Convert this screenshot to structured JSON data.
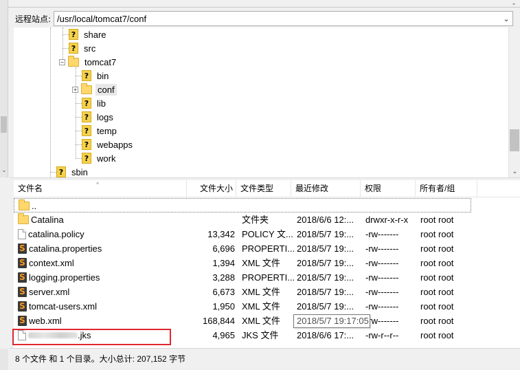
{
  "site_bar": {
    "label": "远程站点:",
    "path": "/usr/local/tomcat7/conf"
  },
  "tree": {
    "items": [
      {
        "label": "share",
        "icon": "question-folder-icon",
        "expander": ""
      },
      {
        "label": "src",
        "icon": "question-folder-icon",
        "expander": ""
      },
      {
        "label": "tomcat7",
        "icon": "folder-icon",
        "expander": "−"
      },
      {
        "label": "bin",
        "icon": "question-folder-icon",
        "expander": ""
      },
      {
        "label": "conf",
        "icon": "folder-icon",
        "expander": "+"
      },
      {
        "label": "lib",
        "icon": "question-folder-icon",
        "expander": ""
      },
      {
        "label": "logs",
        "icon": "question-folder-icon",
        "expander": ""
      },
      {
        "label": "temp",
        "icon": "question-folder-icon",
        "expander": ""
      },
      {
        "label": "webapps",
        "icon": "question-folder-icon",
        "expander": ""
      },
      {
        "label": "work",
        "icon": "question-folder-icon",
        "expander": ""
      },
      {
        "label": "sbin",
        "icon": "question-folder-icon",
        "expander": ""
      }
    ]
  },
  "file_list": {
    "columns": [
      "文件名",
      "文件大小",
      "文件类型",
      "最近修改",
      "权限",
      "所有者/组"
    ],
    "parent": "..",
    "rows": [
      {
        "name": "Catalina",
        "size": "",
        "type": "文件夹",
        "modified": "2018/6/6 12:...",
        "perm": "drwxr-x-r-x",
        "owner": "root root",
        "icon": "folder-icon"
      },
      {
        "name": "catalina.policy",
        "size": "13,342",
        "type": "POLICY 文...",
        "modified": "2018/5/7 19:...",
        "perm": "-rw-------",
        "owner": "root root",
        "icon": "document-icon"
      },
      {
        "name": "catalina.properties",
        "size": "6,696",
        "type": "PROPERTI...",
        "modified": "2018/5/7 19:...",
        "perm": "-rw-------",
        "owner": "root root",
        "icon": "sublime-icon"
      },
      {
        "name": "context.xml",
        "size": "1,394",
        "type": "XML 文件",
        "modified": "2018/5/7 19:...",
        "perm": "-rw-------",
        "owner": "root root",
        "icon": "sublime-icon"
      },
      {
        "name": "logging.properties",
        "size": "3,288",
        "type": "PROPERTI...",
        "modified": "2018/5/7 19:...",
        "perm": "-rw-------",
        "owner": "root root",
        "icon": "sublime-icon"
      },
      {
        "name": "server.xml",
        "size": "6,673",
        "type": "XML 文件",
        "modified": "2018/5/7 19:...",
        "perm": "-rw-------",
        "owner": "root root",
        "icon": "sublime-icon"
      },
      {
        "name": "tomcat-users.xml",
        "size": "1,950",
        "type": "XML 文件",
        "modified": "2018/5/7 19:...",
        "perm": "-rw-------",
        "owner": "root root",
        "icon": "sublime-icon"
      },
      {
        "name": "web.xml",
        "size": "168,844",
        "type": "XML 文件",
        "modified": "",
        "perm": "-rw-------",
        "owner": "root root",
        "icon": "sublime-icon"
      },
      {
        "name": ".jks",
        "size": "4,965",
        "type": "JKS 文件",
        "modified": "2018/6/6 17:...",
        "perm": "-rw-r--r--",
        "owner": "root root",
        "icon": "document-icon"
      }
    ]
  },
  "tooltip": "2018/5/7 19:17:05",
  "status": "8 个文件 和 1 个目录。大小总计: 207,152 字节"
}
